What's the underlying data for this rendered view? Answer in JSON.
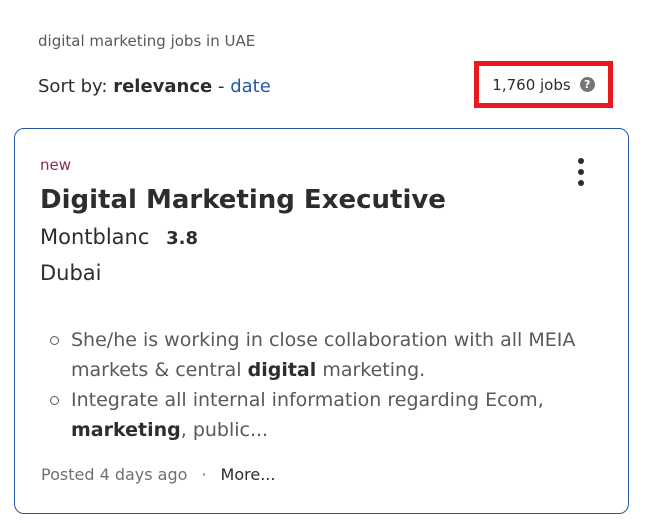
{
  "search": {
    "summary": "digital marketing jobs in UAE"
  },
  "sort": {
    "label": "Sort by:",
    "current": "relevance",
    "separator": "-",
    "alternative": "date"
  },
  "results": {
    "count": "1,760 jobs",
    "help_icon": "question-icon",
    "help_glyph": "?"
  },
  "job": {
    "badge": "new",
    "menu_icon": "kebab-icon",
    "title": "Digital Marketing Executive",
    "company": "Montblanc",
    "rating": "3.8",
    "location": "Dubai",
    "snippet": [
      {
        "before": "She/he is working in close collaboration with all MEIA markets & central ",
        "highlight": "digital",
        "after": " marketing."
      },
      {
        "before": "Integrate all internal information regarding Ecom, ",
        "highlight": "marketing",
        "after": ", public..."
      }
    ],
    "posted": "Posted 4 days ago",
    "separator": "·",
    "more": "More..."
  },
  "colors": {
    "highlight_box": "#e8191f",
    "link": "#2557a7",
    "card_border": "#2557a7",
    "new_badge": "#8a2b5a"
  }
}
